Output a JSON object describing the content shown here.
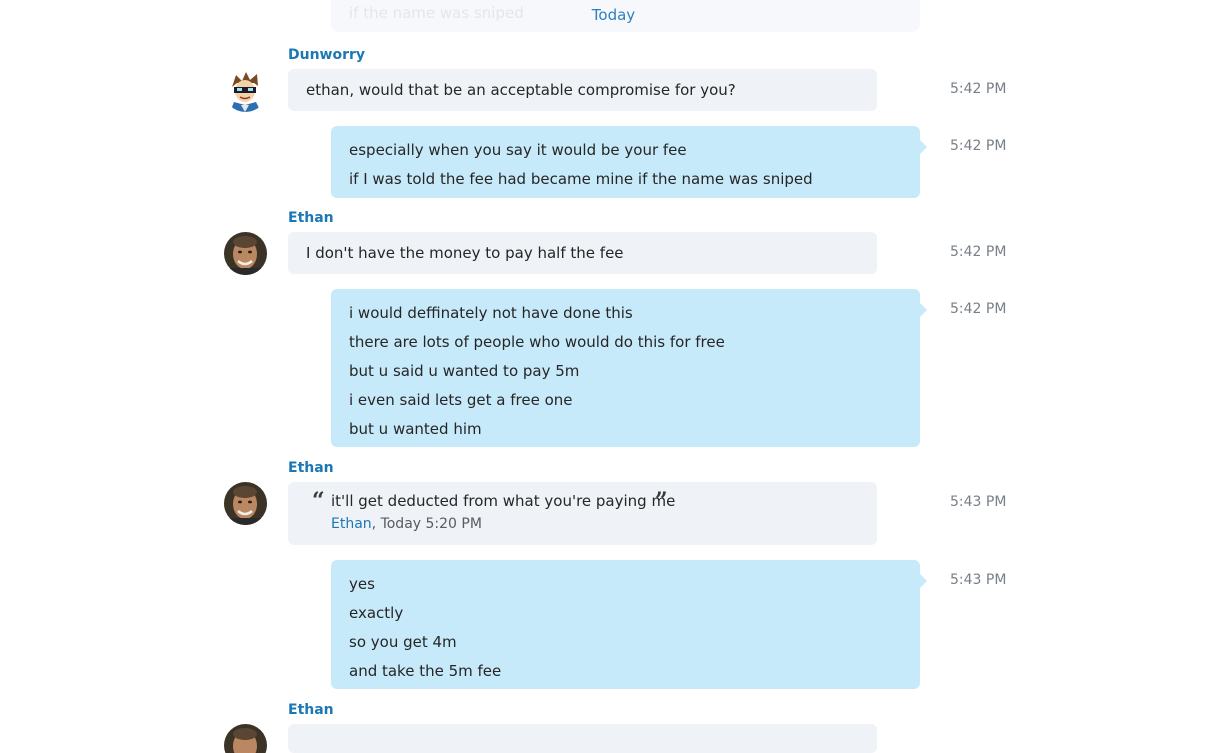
{
  "divider": {
    "faded_previous_text": "if the name was sniped",
    "label": "Today"
  },
  "messages": [
    {
      "sender": "Dunworry",
      "text": "ethan, would that be an acceptable compromise for you?",
      "time": "5:42 PM"
    },
    {
      "lines": [
        "especially when you say it would be your fee",
        "if I was told the fee had became mine if the name was sniped"
      ],
      "time": "5:42 PM"
    },
    {
      "sender": "Ethan",
      "text": "I don't have the money to pay half the fee",
      "time": "5:42 PM"
    },
    {
      "lines": [
        "i would deffinately not have done this",
        "there are lots of people who would do this for free",
        "but u said u wanted to pay 5m",
        "i even said lets get a free one",
        "but u wanted him"
      ],
      "time": "5:42 PM"
    },
    {
      "sender": "Ethan",
      "quote": {
        "open_mark": "“",
        "text": "it'll get deducted from what you're paying me",
        "close_mark": "”",
        "author": "Ethan",
        "meta": ", Today 5:20 PM"
      },
      "time": "5:43 PM"
    },
    {
      "lines": [
        "yes",
        "exactly",
        "so you get 4m",
        "and take the 5m fee"
      ],
      "time": "5:43 PM"
    },
    {
      "sender": "Ethan"
    }
  ]
}
